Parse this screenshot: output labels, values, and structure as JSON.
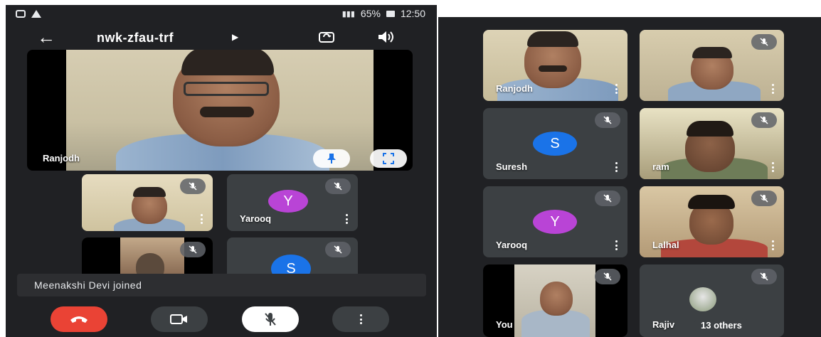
{
  "left_phone": {
    "status_bar": {
      "battery_percent": "65%",
      "time": "12:50"
    },
    "top_bar": {
      "back_icon": "arrow-left-icon",
      "meeting_code": "nwk-zfau-trf",
      "code_menu_icon": "triangle-right-icon",
      "switch_camera_icon": "camera-switch-icon",
      "audio_output_icon": "speaker-icon"
    },
    "main_tile": {
      "participant_name": "Ranjodh",
      "pin_icon": "pin-icon",
      "fullscreen_icon": "fullscreen-icon"
    },
    "tiles": [
      {
        "name": "",
        "type": "video",
        "muted": true
      },
      {
        "name": "Yarooq",
        "type": "avatar",
        "initial": "Y",
        "avatar_color": "#b944d6",
        "muted": true
      },
      {
        "name": "",
        "type": "video",
        "muted": true
      },
      {
        "name": "",
        "type": "avatar",
        "initial": "S",
        "avatar_color": "#1a73e8",
        "muted": true
      }
    ],
    "toast": "Meenakshi Devi joined",
    "controls": {
      "end_call_icon": "end-call-icon",
      "camera_icon": "video-camera-icon",
      "mic_icon": "mic-off-icon",
      "more_icon": "more-vertical-icon",
      "end_call_color": "#ea4335"
    }
  },
  "right_grid": {
    "tiles": [
      {
        "name": "Ranjodh",
        "type": "video",
        "muted": false
      },
      {
        "name": "",
        "type": "video",
        "muted": true
      },
      {
        "name": "Suresh",
        "type": "avatar",
        "initial": "S",
        "avatar_color": "#1a73e8",
        "muted": true
      },
      {
        "name": "ram",
        "type": "video",
        "muted": true
      },
      {
        "name": "Yarooq",
        "type": "avatar",
        "initial": "Y",
        "avatar_color": "#b944d6",
        "muted": true
      },
      {
        "name": "Lalhal",
        "type": "video",
        "muted": true
      },
      {
        "name": "You",
        "type": "video",
        "muted": true
      },
      {
        "name": "Rajiv",
        "type": "avatar-photo",
        "muted": true,
        "others_label": "13 others"
      }
    ]
  },
  "colors": {
    "background": "#202124",
    "tile": "#3c4043",
    "end_call": "#ea4335"
  }
}
